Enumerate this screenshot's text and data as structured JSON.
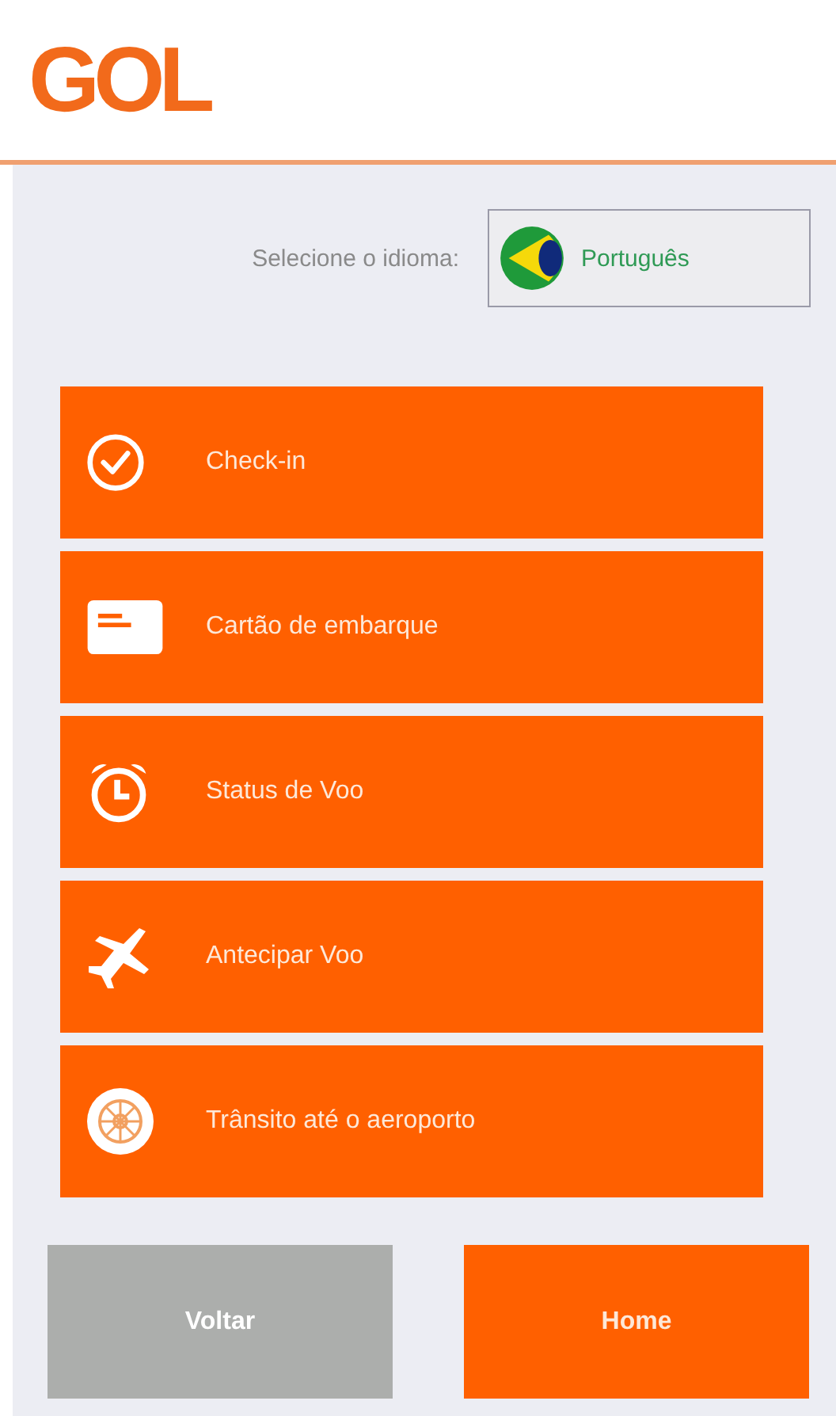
{
  "logo": "GOL",
  "language": {
    "label": "Selecione o idioma:",
    "value": "Português"
  },
  "menu": [
    {
      "label": "Check-in",
      "kind": "check"
    },
    {
      "label": "Cartão de embarque",
      "kind": "card"
    },
    {
      "label": "Status de Voo",
      "kind": "clock"
    },
    {
      "label": "Antecipar Voo",
      "kind": "plane"
    },
    {
      "label": "Trânsito até o aeroporto",
      "kind": "wheel"
    }
  ],
  "buttons": [
    {
      "label": "Voltar",
      "kind": "secondary"
    },
    {
      "label": "Home",
      "kind": "primary"
    }
  ]
}
